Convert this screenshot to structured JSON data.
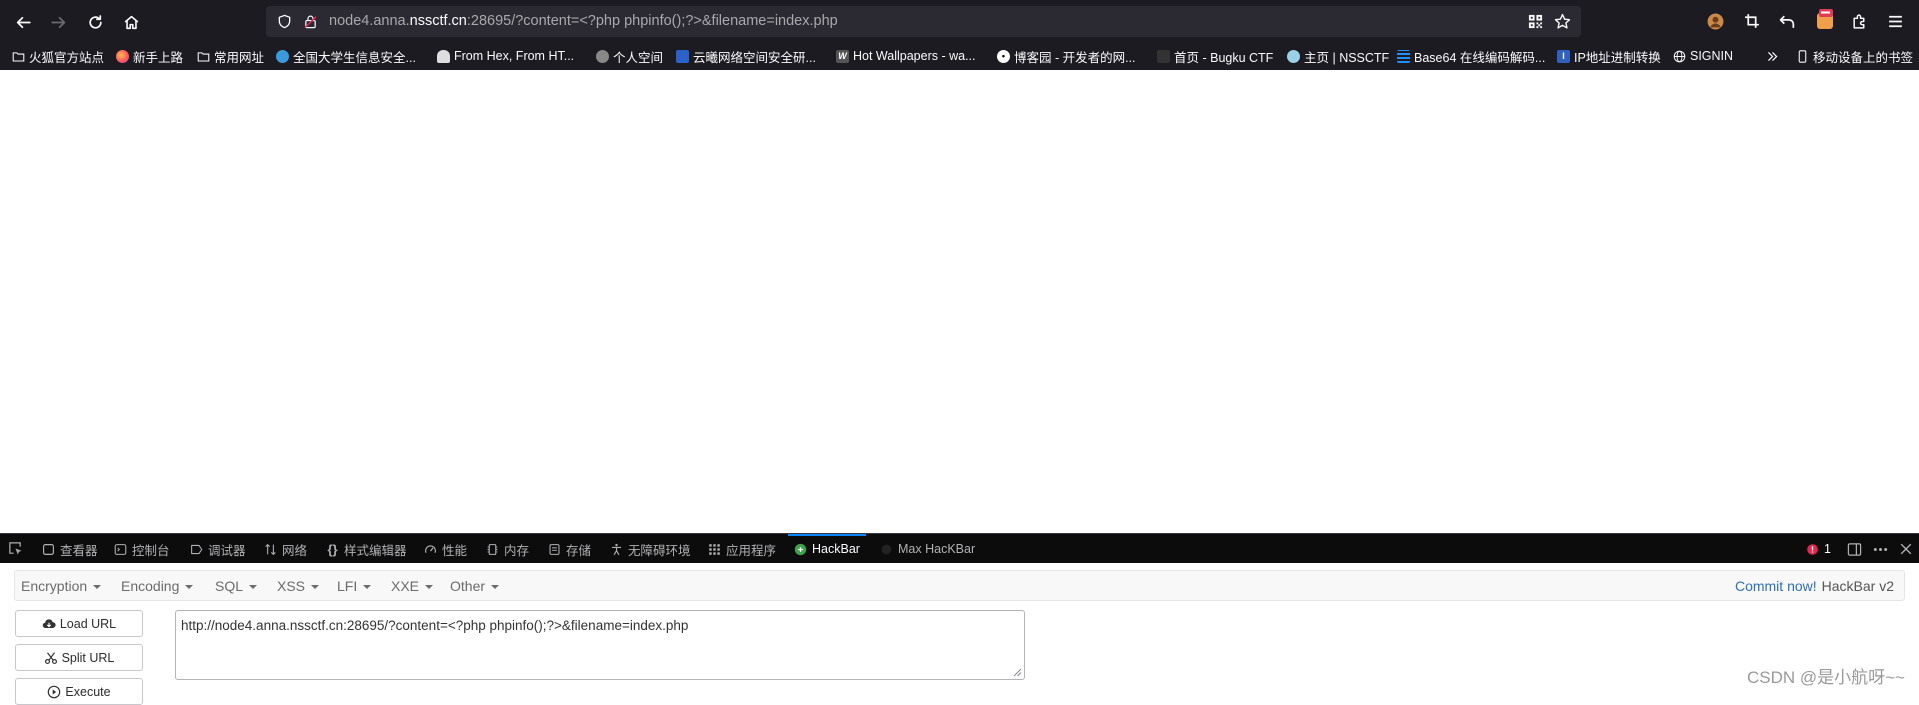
{
  "browser": {
    "url_prefix": "node4.anna.",
    "url_domain": "nssctf.cn",
    "url_suffix": ":28695/?content=<?php phpinfo();?>&filename=index.php"
  },
  "bookmarks": [
    {
      "label": "火狐官方站点",
      "icon": "folder-icon",
      "color": "#fbfbfe"
    },
    {
      "label": "新手上路",
      "icon": "firefox-icon",
      "color": "#ff7139"
    },
    {
      "label": "常用网址",
      "icon": "folder-icon",
      "color": "#fbfbfe"
    },
    {
      "label": "全国大学生信息安全...",
      "icon": "globe-favicon",
      "color": "#3a9bdc"
    },
    {
      "label": "From Hex, From HT...",
      "icon": "chef-favicon",
      "color": "#dddddd"
    },
    {
      "label": "个人空间",
      "icon": "globe-favicon",
      "color": "#888888"
    },
    {
      "label": "云曦网络空间安全研...",
      "icon": "site-favicon",
      "color": "#2a62c9"
    },
    {
      "label": "Hot Wallpapers - wa...",
      "icon": "wallpaper-favicon",
      "color": "#555555"
    },
    {
      "label": "博客园 - 开发者的网...",
      "icon": "cnblogs-favicon",
      "color": "#ffffff"
    },
    {
      "label": "首页 - Bugku CTF",
      "icon": "bugku-favicon",
      "color": "#333333"
    },
    {
      "label": "主页 | NSSCTF",
      "icon": "nssctf-favicon",
      "color": "#9ad0e8"
    },
    {
      "label": "Base64 在线编码解码...",
      "icon": "base64-favicon",
      "color": "#1e90ff"
    },
    {
      "label": "IP地址进制转换",
      "icon": "ip-favicon",
      "color": "#3060c0"
    },
    {
      "label": "SIGNIN",
      "icon": "globe-icon",
      "color": "#fbfbfe"
    }
  ],
  "mobile_bookmarks": "移动设备上的书签",
  "devtools": {
    "tabs": [
      {
        "label": "查看器",
        "icon": "inspector-icon"
      },
      {
        "label": "控制台",
        "icon": "console-icon"
      },
      {
        "label": "调试器",
        "icon": "debugger-icon"
      },
      {
        "label": "网络",
        "icon": "network-icon"
      },
      {
        "label": "样式编辑器",
        "icon": "style-editor-icon"
      },
      {
        "label": "性能",
        "icon": "performance-icon"
      },
      {
        "label": "内存",
        "icon": "memory-icon"
      },
      {
        "label": "存储",
        "icon": "storage-icon"
      },
      {
        "label": "无障碍环境",
        "icon": "accessibility-icon"
      },
      {
        "label": "应用程序",
        "icon": "application-icon"
      },
      {
        "label": "HackBar",
        "icon": "hackbar-icon"
      },
      {
        "label": "Max HacKBar",
        "icon": "max-hackbar-icon"
      }
    ],
    "active_tab": "HackBar",
    "error_count": "1"
  },
  "hackbar": {
    "menu": [
      "Encryption",
      "Encoding",
      "SQL",
      "XSS",
      "LFI",
      "XXE",
      "Other"
    ],
    "commit_label": "Commit now!",
    "version": "HackBar v2",
    "load_url": "Load URL",
    "split_url": "Split URL",
    "execute": "Execute",
    "url_value": "http://node4.anna.nssctf.cn:28695/?content=<?php phpinfo();?>&filename=index.php"
  },
  "watermark": "CSDN @是小航呀~~"
}
